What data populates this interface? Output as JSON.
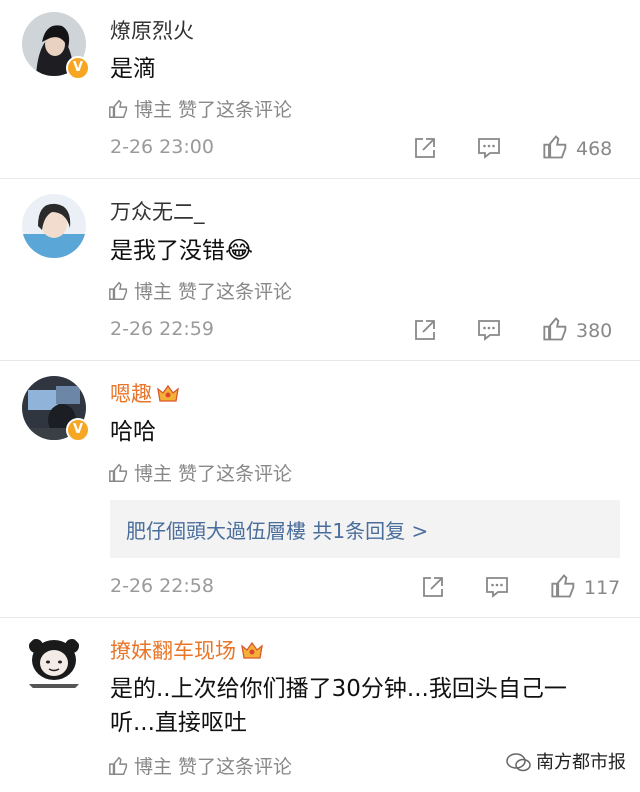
{
  "comments": [
    {
      "username": "燎原烈火",
      "text": "是滴",
      "author_liked": "博主 赞了这条评论",
      "time": "2-26 23:00",
      "likes": "468",
      "verified": "V"
    },
    {
      "username": "万众无二_",
      "text": "是我了没错",
      "emoji": "😂",
      "author_liked": "博主 赞了这条评论",
      "time": "2-26 22:59",
      "likes": "380"
    },
    {
      "username": "嗯趣",
      "text": "哈哈",
      "author_liked": "博主 赞了这条评论",
      "reply_link": "肥仔個頭大過伍層樓  共1条回复 >",
      "time": "2-26 22:58",
      "likes": "117",
      "verified": "V"
    },
    {
      "username": "撩妹翻车现场",
      "text_line1": "是的..上次给你们播了30分钟...我回头自己一",
      "text_line2": "听...直接呕吐",
      "author_liked": "博主 赞了这条评论"
    }
  ],
  "watermark": "南方都市报",
  "colors": {
    "vip_name": "#e8762a",
    "link": "#4a6e9c",
    "meta": "#9a9a9a",
    "badge": "#f6a623"
  }
}
